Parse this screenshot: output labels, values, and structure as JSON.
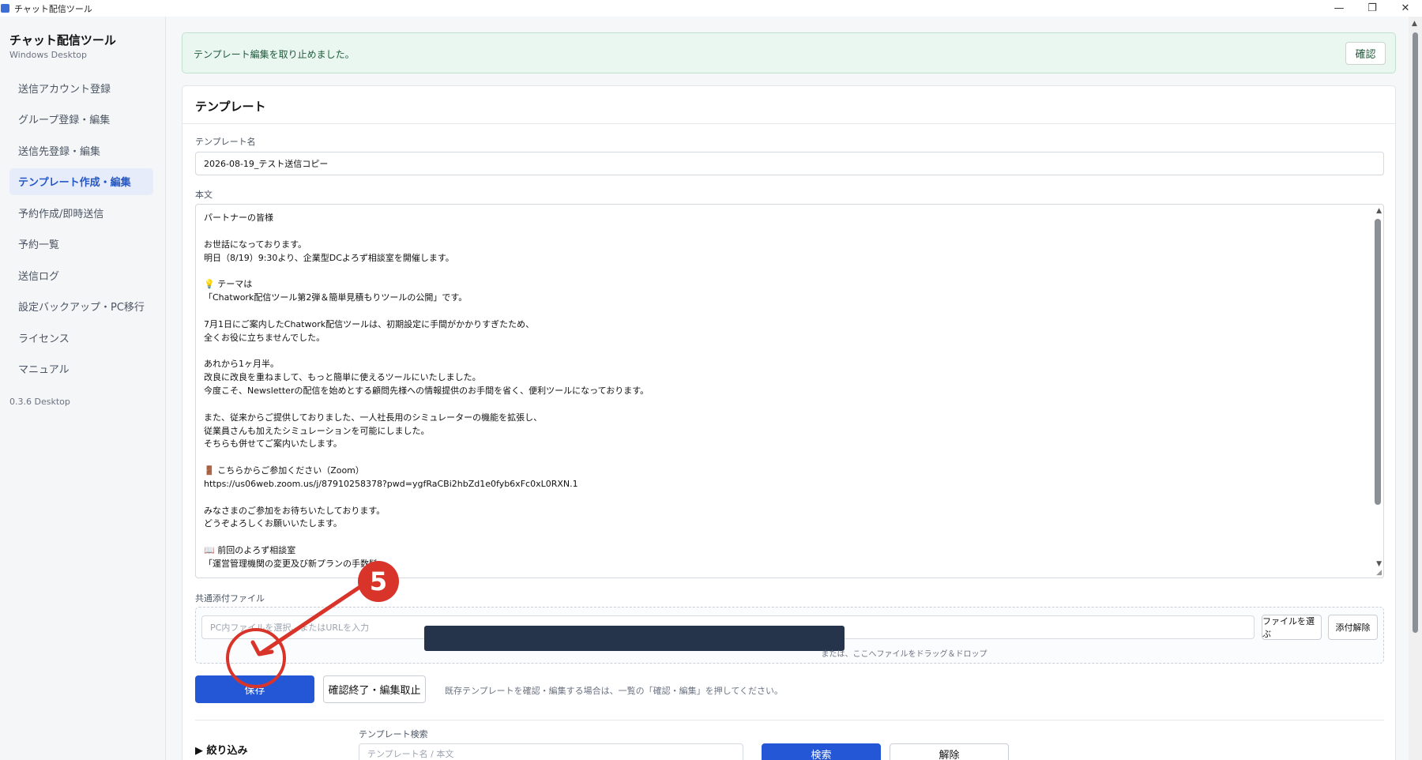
{
  "window": {
    "title": "チャット配信ツール",
    "minimize": "—",
    "maximize": "❐",
    "close": "✕"
  },
  "sidebar": {
    "app_title": "チャット配信ツール",
    "app_subtitle": "Windows Desktop",
    "items": [
      {
        "label": "送信アカウント登録"
      },
      {
        "label": "グループ登録・編集"
      },
      {
        "label": "送信先登録・編集"
      },
      {
        "label": "テンプレート作成・編集"
      },
      {
        "label": "予約作成/即時送信"
      },
      {
        "label": "予約一覧"
      },
      {
        "label": "送信ログ"
      },
      {
        "label": "設定バックアップ・PC移行"
      },
      {
        "label": "ライセンス"
      },
      {
        "label": "マニュアル"
      }
    ],
    "active_index": 3,
    "version": "0.3.6 Desktop"
  },
  "alert": {
    "message": "テンプレート編集を取り止めました。",
    "button": "確認"
  },
  "template": {
    "card_title": "テンプレート",
    "name_label": "テンプレート名",
    "name_value": "2026-08-19_テスト送信コピー",
    "body_label": "本文",
    "body_text": "パートナーの皆様\n\nお世話になっております。\n明日（8/19）9:30より、企業型DCよろず相談室を開催します。\n\n💡 テーマは\n「Chatwork配信ツール第2弾＆簡単見積もりツールの公開」です。\n\n7月1日にご案内したChatwork配信ツールは、初期設定に手間がかかりすぎたため、\n全くお役に立ちませんでした。\n\nあれから1ヶ月半。\n改良に改良を重ねまして、もっと簡単に使えるツールにいたしました。\n今度こそ、Newsletterの配信を始めとする顧問先様への情報提供のお手間を省く、便利ツールになっております。\n\nまた、従来からご提供しておりました、一人社長用のシミュレーターの機能を拡張し、\n従業員さんも加えたシミュレーションを可能にしました。\nそちらも併せてご案内いたします。\n\n🚪 こちらからご参加ください（Zoom）\nhttps://us06web.zoom.us/j/87910258378?pwd=ygfRaCBi2hbZd1e0fyb6xFc0xL0RXN.1\n\nみなさまのご参加をお待ちいたしております。\nどうぞよろしくお願いいたします。\n\n📖 前回のよろず相談室\n「運営管理機関の変更及び新プランの手数料",
    "attach_label": "共通添付ファイル",
    "attach_placeholder": "PC内ファイルを選択、またはURLを入力",
    "choose_file": "ファイルを選ぶ",
    "remove_attach": "添付解除",
    "drop_hint": "または、ここへファイルをドラッグ＆ドロップ",
    "save": "保存",
    "cancel_edit": "確認終了・編集取止",
    "hint": "既存テンプレートを確認・編集する場合は、一覧の「確認・編集」を押してください。"
  },
  "search": {
    "filter_toggle": "▶ 絞り込み",
    "label": "テンプレート検索",
    "placeholder": "テンプレート名 / 本文",
    "search_button": "検索",
    "clear_button": "解除"
  },
  "annotation": {
    "step": "5",
    "color": "#d8342a"
  }
}
